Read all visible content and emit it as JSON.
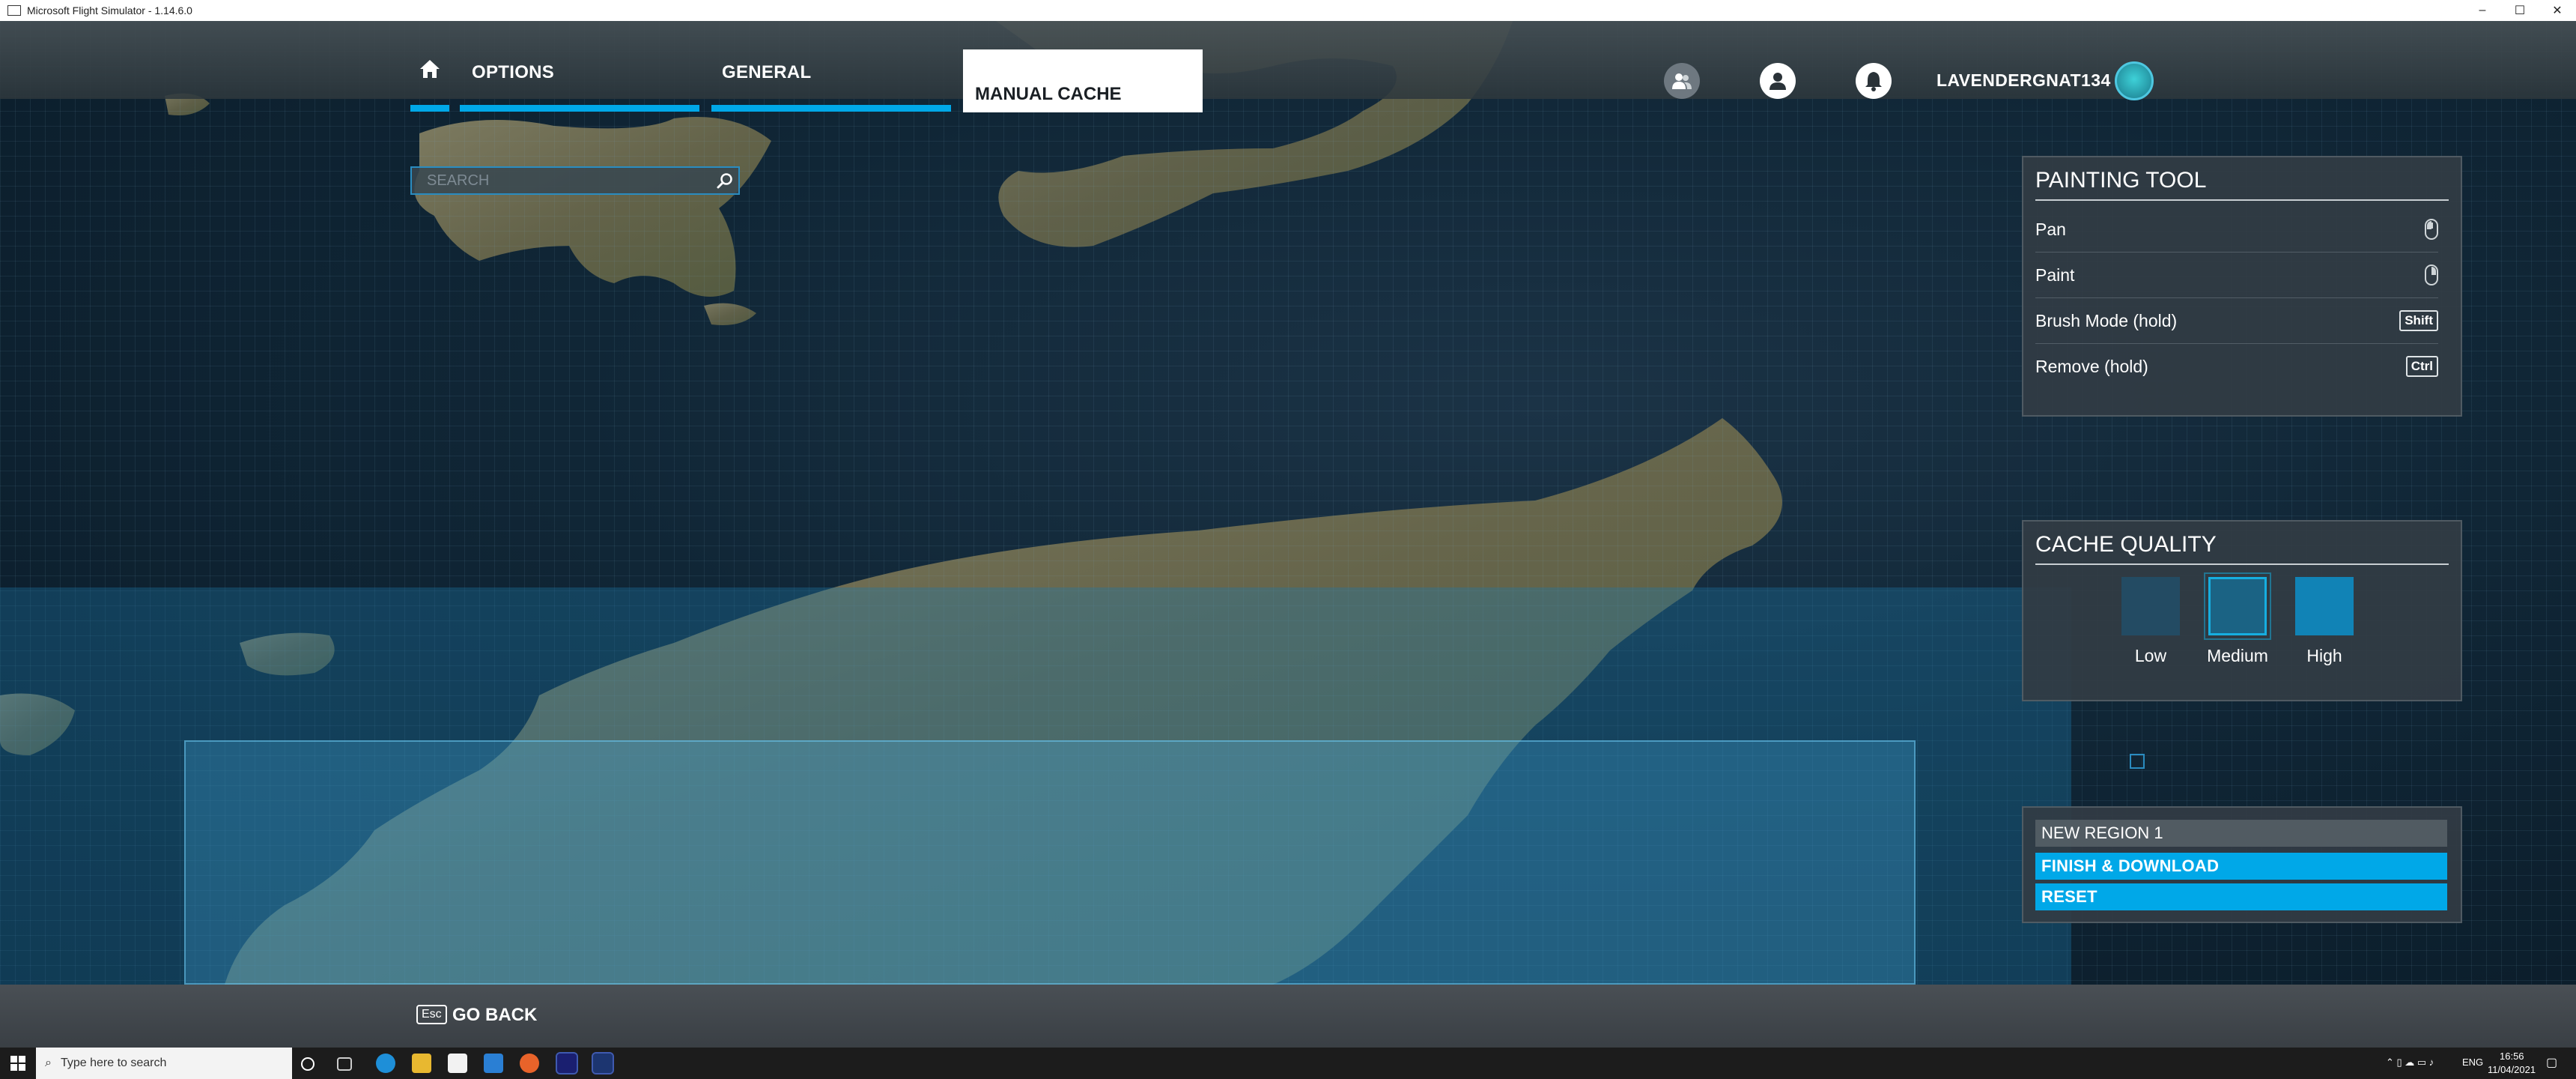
{
  "window": {
    "title": "Microsoft Flight Simulator - 1.14.6.0",
    "controls": [
      "–",
      "☐",
      "✕"
    ]
  },
  "nav": {
    "home_icon": "home-icon",
    "tabs": [
      {
        "label": "OPTIONS"
      },
      {
        "label": "GENERAL"
      },
      {
        "label": "MANUAL CACHE",
        "active": true
      }
    ],
    "username": "LAVENDERGNAT134",
    "accent": "#00a8e8"
  },
  "search": {
    "placeholder": "SEARCH",
    "value": ""
  },
  "painting_tool": {
    "title": "PAINTING TOOL",
    "rows": [
      {
        "label": "Pan",
        "control": "mouse-left"
      },
      {
        "label": "Paint",
        "control": "mouse-right"
      },
      {
        "label": "Brush Mode (hold)",
        "key": "Shift"
      },
      {
        "label": "Remove (hold)",
        "key": "Ctrl"
      }
    ]
  },
  "cache_quality": {
    "title": "CACHE QUALITY",
    "options": [
      {
        "label": "Low",
        "color": "#234b63"
      },
      {
        "label": "Medium",
        "color": "#1b6384",
        "selected": true
      },
      {
        "label": "High",
        "color": "#1183b6"
      }
    ]
  },
  "region": {
    "name": "NEW REGION 1",
    "finish_label": "FINISH & DOWNLOAD",
    "reset_label": "RESET"
  },
  "bottom": {
    "esc_key": "Esc",
    "go_back_label": "GO BACK"
  },
  "taskbar": {
    "search_placeholder": "Type here to search",
    "lang": "ENG",
    "time": "16:56",
    "date": "11/04/2021"
  }
}
